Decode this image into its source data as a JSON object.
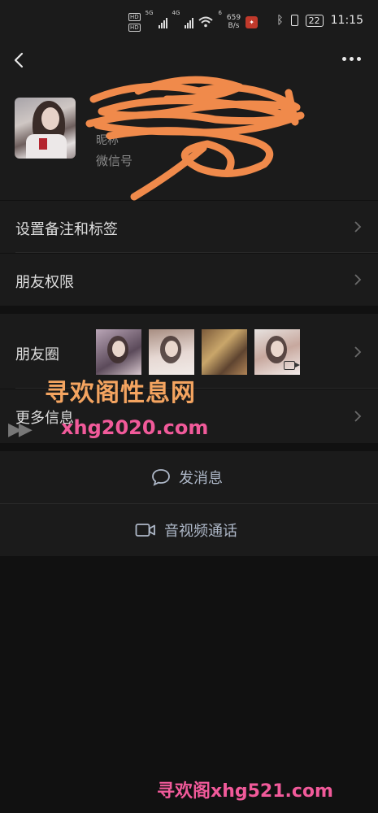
{
  "status_bar": {
    "hd_labels": [
      "HD",
      "HD"
    ],
    "net_labels": [
      "5G",
      "4G",
      "6"
    ],
    "speed_value": "659",
    "speed_unit": "B/s",
    "battery": "22",
    "time": "11:15"
  },
  "profile": {
    "nickname": "",
    "subline": "昵称",
    "wechat_id": "微信号"
  },
  "menu": {
    "remark_tags": "设置备注和标签",
    "friend_permissions": "朋友权限",
    "moments": "朋友圈",
    "more_info": "更多信息"
  },
  "actions": {
    "send_message": "发消息",
    "video_call": "音视频通话"
  },
  "watermarks": {
    "title": "寻欢阁性息网",
    "url": "xhg2020.com",
    "footer": "寻欢阁xhg521.com"
  },
  "colors": {
    "background": "#111111",
    "panel": "#1b1b1b",
    "scribble": "#f08a4b",
    "action_text": "#aeb8c8"
  }
}
